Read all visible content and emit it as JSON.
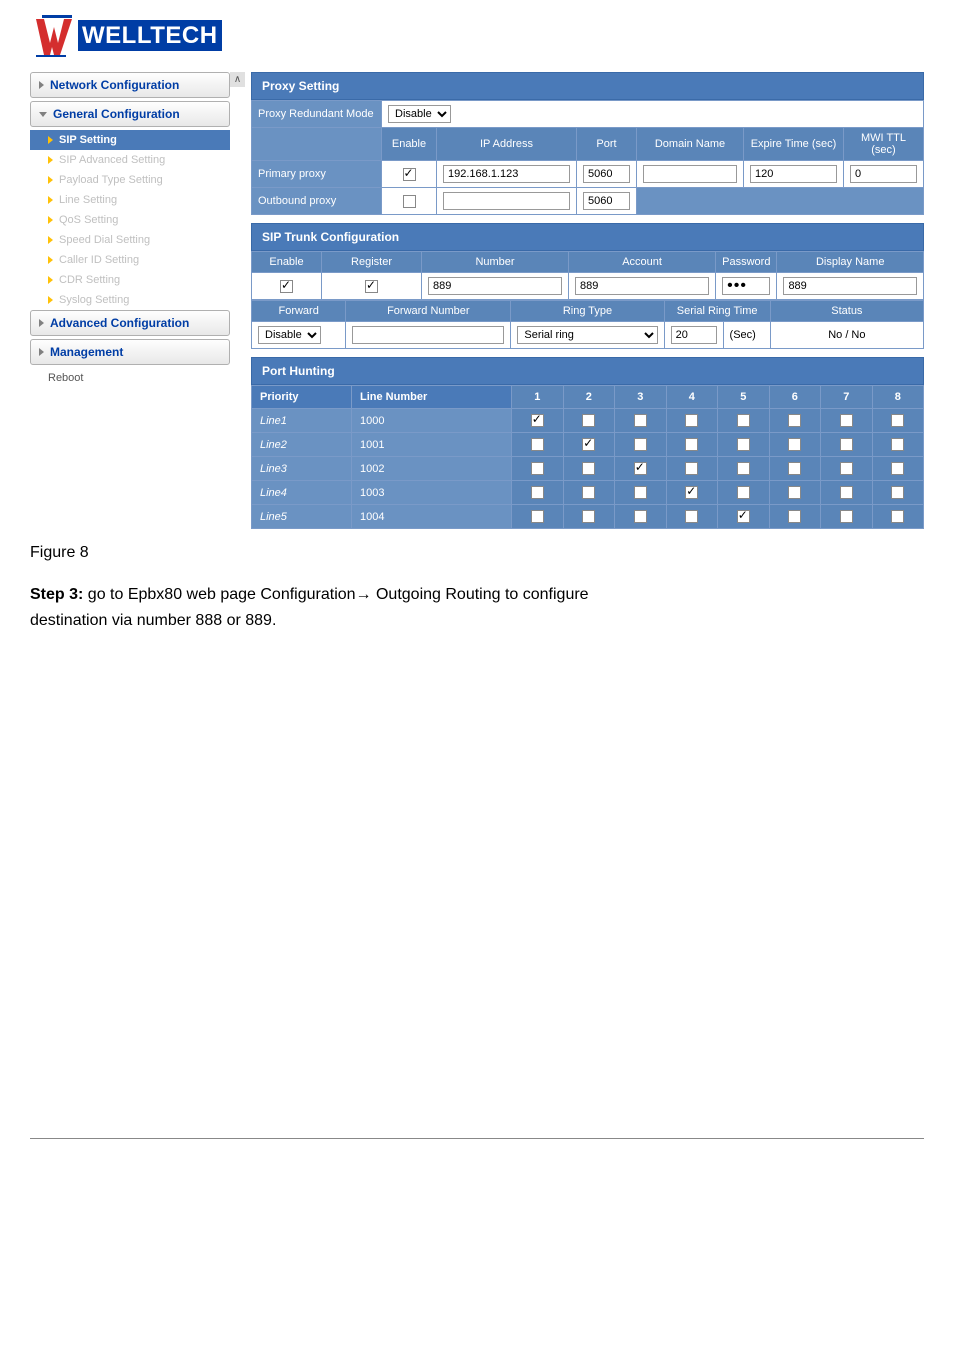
{
  "logo": {
    "text": "WELLTECH"
  },
  "sidebar": {
    "items": [
      {
        "label": "Network Configuration",
        "type": "nav"
      },
      {
        "label": "General Configuration",
        "type": "nav"
      },
      {
        "label": "SIP Setting",
        "type": "sub",
        "active": true
      },
      {
        "label": "SIP Advanced Setting",
        "type": "sub"
      },
      {
        "label": "Payload Type Setting",
        "type": "sub"
      },
      {
        "label": "Line Setting",
        "type": "sub"
      },
      {
        "label": "QoS Setting",
        "type": "sub"
      },
      {
        "label": "Speed Dial Setting",
        "type": "sub"
      },
      {
        "label": "Caller ID Setting",
        "type": "sub"
      },
      {
        "label": "CDR Setting",
        "type": "sub"
      },
      {
        "label": "Syslog Setting",
        "type": "sub"
      },
      {
        "label": "Advanced Configuration",
        "type": "nav"
      },
      {
        "label": "Management",
        "type": "nav"
      },
      {
        "label": "Reboot",
        "type": "sub-plain"
      }
    ]
  },
  "proxy": {
    "title": "Proxy Setting",
    "redundant_label": "Proxy Redundant Mode",
    "redundant_value": "Disable",
    "cols": {
      "enable": "Enable",
      "ip": "IP Address",
      "port": "Port",
      "domain": "Domain Name",
      "expire": "Expire Time (sec)",
      "mwi": "MWI TTL (sec)"
    },
    "primary": {
      "label": "Primary proxy",
      "enable": true,
      "ip": "192.168.1.123",
      "port": "5060",
      "domain": "",
      "expire": "120",
      "mwi": "0"
    },
    "outbound": {
      "label": "Outbound proxy",
      "enable": false,
      "ip": "",
      "port": "5060"
    }
  },
  "trunk": {
    "title": "SIP Trunk Configuration",
    "cols": {
      "enable": "Enable",
      "register": "Register",
      "number": "Number",
      "account": "Account",
      "password": "Password",
      "display": "Display Name"
    },
    "row": {
      "enable": true,
      "register": true,
      "number": "889",
      "account": "889",
      "password": "•••",
      "display": "889"
    },
    "fwd": {
      "forward_label": "Forward",
      "forward_value": "Disable",
      "fwdnum_label": "Forward Number",
      "ring_label": "Ring Type",
      "ring_value": "Serial ring",
      "srt_label": "Serial Ring Time",
      "srt_value": "20",
      "srt_unit": "(Sec)",
      "status_label": "Status",
      "status_value": "No / No"
    }
  },
  "hunting": {
    "title": "Port Hunting",
    "priority": "Priority",
    "linenum": "Line Number",
    "cols": [
      "1",
      "2",
      "3",
      "4",
      "5",
      "6",
      "7",
      "8"
    ],
    "rows": [
      {
        "label": "Line1",
        "num": "1000",
        "checks": [
          true,
          false,
          false,
          false,
          false,
          false,
          false,
          false
        ]
      },
      {
        "label": "Line2",
        "num": "1001",
        "checks": [
          false,
          true,
          false,
          false,
          false,
          false,
          false,
          false
        ]
      },
      {
        "label": "Line3",
        "num": "1002",
        "checks": [
          false,
          false,
          true,
          false,
          false,
          false,
          false,
          false
        ]
      },
      {
        "label": "Line4",
        "num": "1003",
        "checks": [
          false,
          false,
          false,
          true,
          false,
          false,
          false,
          false
        ]
      },
      {
        "label": "Line5",
        "num": "1004",
        "checks": [
          false,
          false,
          false,
          false,
          true,
          false,
          false,
          false
        ]
      }
    ]
  },
  "caption": "Figure 8",
  "step": {
    "prefix": "Step 3:",
    "line1": " go to Epbx80 web page Configuration→ Outgoing Routing to configure",
    "line2": "destination via number 888 or 889."
  }
}
